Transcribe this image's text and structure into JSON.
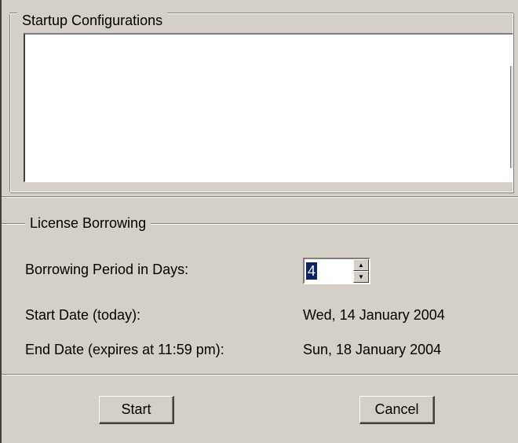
{
  "startup": {
    "legend": "Startup Configurations",
    "items": []
  },
  "borrowing": {
    "legend": "License Borrowing",
    "period_label": "Borrowing Period in Days:",
    "period_value": "4",
    "start_label": "Start Date (today):",
    "start_value": "Wed, 14 January 2004",
    "end_label": "End Date (expires at 11:59 pm):",
    "end_value": "Sun, 18 January 2004"
  },
  "spinner": {
    "up_icon": "arrow-up-icon",
    "down_icon": "arrow-down-icon"
  },
  "buttons": {
    "start_label": "Start",
    "cancel_label": "Cancel"
  }
}
